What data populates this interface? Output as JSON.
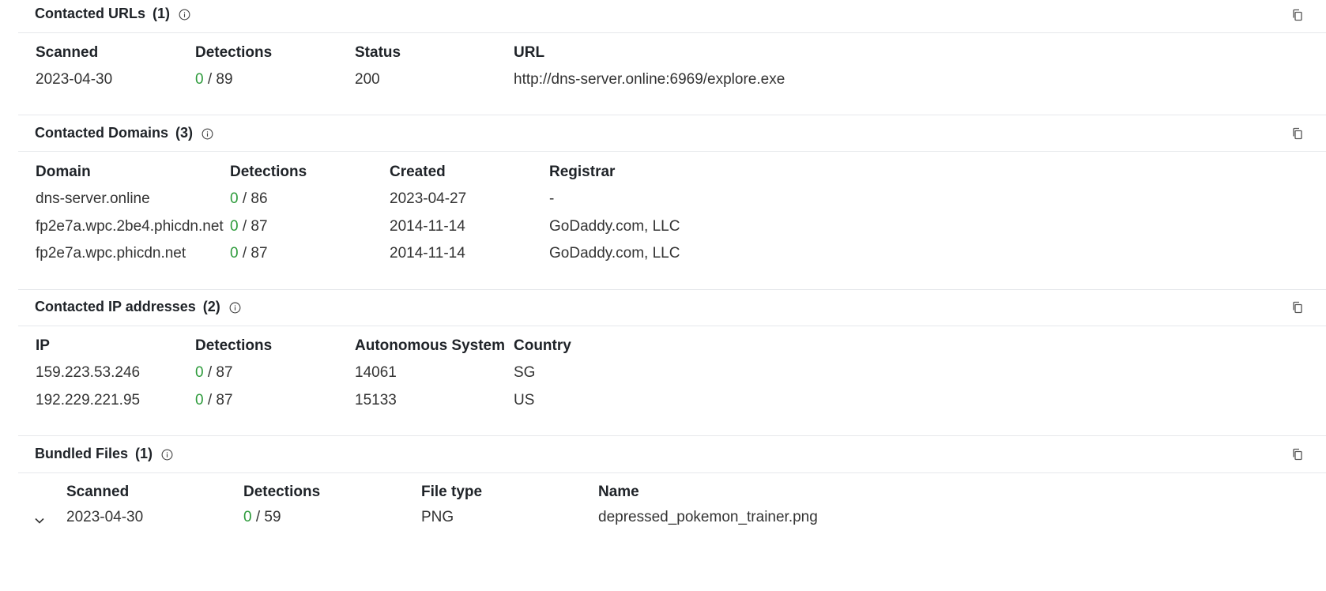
{
  "sections": {
    "urls": {
      "title": "Contacted URLs",
      "count": "(1)",
      "headers": [
        "Scanned",
        "Detections",
        "Status",
        "URL"
      ],
      "rows": [
        {
          "scanned": "2023-04-30",
          "det_pos": "0",
          "det_total": " / 89",
          "status": "200",
          "url": "http://dns-server.online:6969/explore.exe"
        }
      ]
    },
    "domains": {
      "title": "Contacted Domains",
      "count": "(3)",
      "headers": [
        "Domain",
        "Detections",
        "Created",
        "Registrar"
      ],
      "rows": [
        {
          "domain": "dns-server.online",
          "det_pos": "0",
          "det_total": " / 86",
          "created": "2023-04-27",
          "registrar": "-"
        },
        {
          "domain": "fp2e7a.wpc.2be4.phicdn.net",
          "det_pos": "0",
          "det_total": " / 87",
          "created": "2014-11-14",
          "registrar": "GoDaddy.com, LLC"
        },
        {
          "domain": "fp2e7a.wpc.phicdn.net",
          "det_pos": "0",
          "det_total": " / 87",
          "created": "2014-11-14",
          "registrar": "GoDaddy.com, LLC"
        }
      ]
    },
    "ips": {
      "title": "Contacted IP addresses",
      "count": "(2)",
      "headers": [
        "IP",
        "Detections",
        "Autonomous System",
        "Country"
      ],
      "rows": [
        {
          "ip": "159.223.53.246",
          "det_pos": "0",
          "det_total": " / 87",
          "asn": "14061",
          "country": "SG"
        },
        {
          "ip": "192.229.221.95",
          "det_pos": "0",
          "det_total": " / 87",
          "asn": "15133",
          "country": "US"
        }
      ]
    },
    "bundled": {
      "title": "Bundled Files",
      "count": "(1)",
      "headers": [
        "Scanned",
        "Detections",
        "File type",
        "Name"
      ],
      "rows": [
        {
          "scanned": "2023-04-30",
          "det_pos": "0",
          "det_total": " / 59",
          "filetype": "PNG",
          "name": "depressed_pokemon_trainer.png"
        }
      ]
    }
  },
  "icons": {
    "info": "info-icon",
    "copy": "copy-icon",
    "expand": "chevron-down-icon"
  },
  "colors": {
    "detection_clean": "#2e9b3c",
    "divider": "#e6e8eb"
  }
}
